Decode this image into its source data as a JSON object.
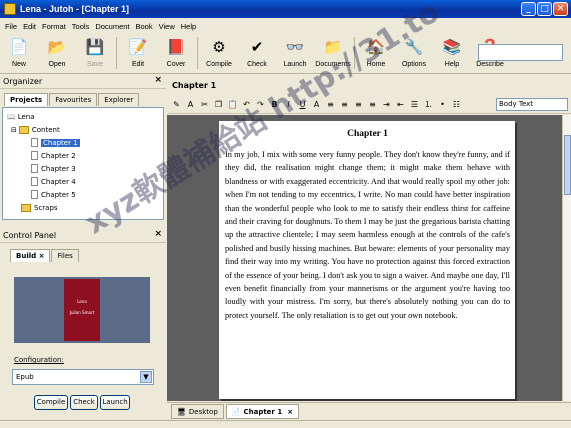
{
  "window": {
    "title": "Lena - Jutoh - [Chapter 1]",
    "min": "_",
    "max": "□",
    "close": "✕"
  },
  "menu": [
    "File",
    "Edit",
    "Format",
    "Tools",
    "Document",
    "Book",
    "View",
    "Help"
  ],
  "toolbar": [
    {
      "label": "New",
      "icon": "new-icon",
      "glyph": "📄"
    },
    {
      "label": "Open",
      "icon": "open-icon",
      "glyph": "📂"
    },
    {
      "label": "Save",
      "icon": "save-icon",
      "glyph": "💾",
      "disabled": true
    },
    {
      "label": "Edit",
      "icon": "edit-icon",
      "glyph": "📝"
    },
    {
      "label": "Cover",
      "icon": "cover-icon",
      "glyph": "📕"
    },
    {
      "label": "Compile",
      "icon": "compile-icon",
      "glyph": "⚙"
    },
    {
      "label": "Check",
      "icon": "check-icon",
      "glyph": "✔"
    },
    {
      "label": "Launch",
      "icon": "launch-icon",
      "glyph": "👓"
    },
    {
      "label": "Documents",
      "icon": "documents-icon",
      "glyph": "📁"
    },
    {
      "label": "Home",
      "icon": "home-icon",
      "glyph": "🏠"
    },
    {
      "label": "Options",
      "icon": "options-icon",
      "glyph": "🔧"
    },
    {
      "label": "Help",
      "icon": "help-icon",
      "glyph": "📚"
    },
    {
      "label": "Describe",
      "icon": "describe-icon",
      "glyph": "❓"
    }
  ],
  "organizer": {
    "title": "Organizer",
    "tabs": [
      "Projects",
      "Favourites",
      "Explorer"
    ],
    "root": "Lena",
    "folder": "Content",
    "chapters": [
      "Chapter 1",
      "Chapter 2",
      "Chapter 3",
      "Chapter 4",
      "Chapter 5"
    ],
    "scraps": "Scraps"
  },
  "control_panel": {
    "title": "Control Panel",
    "tabs": [
      "Build",
      "Files"
    ],
    "cover_title": "Lena",
    "cover_author": "Julian Smart",
    "config_label": "Configuration:",
    "config_value": "Epub",
    "buttons": [
      "Compile",
      "Check",
      "Launch"
    ]
  },
  "document": {
    "header": "Chapter 1",
    "style": "Body Text",
    "heading": "Chapter 1",
    "body": "In my job, I mix with some very funny people. They don't know they're funny, and if they did, the realisation might change them; it might make them behave with blandness or with exaggerated eccentricity. And that would really spoil my other job: when I'm not tending to my eccentrics, I write. No man could have better inspiration than the wonderful people who look to me to satisfy their endless thirst for caffeine and their craving for doughnuts. To them I may be just the gregarious barista chatting up the attractive clientele; I may seem harmless enough at the controls of the cafe's polished and busily hissing machines. But beware: elements of your personality may find their way into my writing. You have no protection against this forced extraction of the essence of your being. I don't ask you to sign a waiver. And maybe one day, I'll even benefit financially from your mannerisms or the argument you're having too loudly with your mistress. I'm sorry, but there's absolutely nothing you can do to protect yourself. The only retaliation is to get out your own notebook."
  },
  "bottom_tabs": [
    "Desktop",
    "Chapter 1"
  ],
  "watermark": "xyz軟體補給站 http://31.to"
}
